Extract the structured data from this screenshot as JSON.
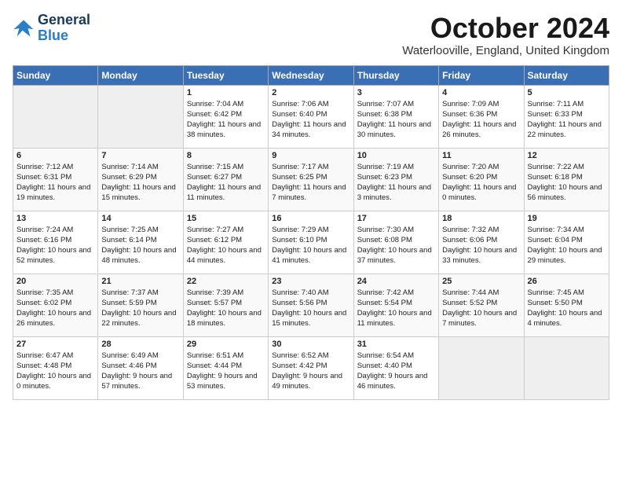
{
  "header": {
    "logo_general": "General",
    "logo_blue": "Blue",
    "month": "October 2024",
    "location": "Waterlooville, England, United Kingdom"
  },
  "weekdays": [
    "Sunday",
    "Monday",
    "Tuesday",
    "Wednesday",
    "Thursday",
    "Friday",
    "Saturday"
  ],
  "weeks": [
    [
      {
        "day": "",
        "info": ""
      },
      {
        "day": "",
        "info": ""
      },
      {
        "day": "1",
        "info": "Sunrise: 7:04 AM\nSunset: 6:42 PM\nDaylight: 11 hours and 38 minutes."
      },
      {
        "day": "2",
        "info": "Sunrise: 7:06 AM\nSunset: 6:40 PM\nDaylight: 11 hours and 34 minutes."
      },
      {
        "day": "3",
        "info": "Sunrise: 7:07 AM\nSunset: 6:38 PM\nDaylight: 11 hours and 30 minutes."
      },
      {
        "day": "4",
        "info": "Sunrise: 7:09 AM\nSunset: 6:36 PM\nDaylight: 11 hours and 26 minutes."
      },
      {
        "day": "5",
        "info": "Sunrise: 7:11 AM\nSunset: 6:33 PM\nDaylight: 11 hours and 22 minutes."
      }
    ],
    [
      {
        "day": "6",
        "info": "Sunrise: 7:12 AM\nSunset: 6:31 PM\nDaylight: 11 hours and 19 minutes."
      },
      {
        "day": "7",
        "info": "Sunrise: 7:14 AM\nSunset: 6:29 PM\nDaylight: 11 hours and 15 minutes."
      },
      {
        "day": "8",
        "info": "Sunrise: 7:15 AM\nSunset: 6:27 PM\nDaylight: 11 hours and 11 minutes."
      },
      {
        "day": "9",
        "info": "Sunrise: 7:17 AM\nSunset: 6:25 PM\nDaylight: 11 hours and 7 minutes."
      },
      {
        "day": "10",
        "info": "Sunrise: 7:19 AM\nSunset: 6:23 PM\nDaylight: 11 hours and 3 minutes."
      },
      {
        "day": "11",
        "info": "Sunrise: 7:20 AM\nSunset: 6:20 PM\nDaylight: 11 hours and 0 minutes."
      },
      {
        "day": "12",
        "info": "Sunrise: 7:22 AM\nSunset: 6:18 PM\nDaylight: 10 hours and 56 minutes."
      }
    ],
    [
      {
        "day": "13",
        "info": "Sunrise: 7:24 AM\nSunset: 6:16 PM\nDaylight: 10 hours and 52 minutes."
      },
      {
        "day": "14",
        "info": "Sunrise: 7:25 AM\nSunset: 6:14 PM\nDaylight: 10 hours and 48 minutes."
      },
      {
        "day": "15",
        "info": "Sunrise: 7:27 AM\nSunset: 6:12 PM\nDaylight: 10 hours and 44 minutes."
      },
      {
        "day": "16",
        "info": "Sunrise: 7:29 AM\nSunset: 6:10 PM\nDaylight: 10 hours and 41 minutes."
      },
      {
        "day": "17",
        "info": "Sunrise: 7:30 AM\nSunset: 6:08 PM\nDaylight: 10 hours and 37 minutes."
      },
      {
        "day": "18",
        "info": "Sunrise: 7:32 AM\nSunset: 6:06 PM\nDaylight: 10 hours and 33 minutes."
      },
      {
        "day": "19",
        "info": "Sunrise: 7:34 AM\nSunset: 6:04 PM\nDaylight: 10 hours and 29 minutes."
      }
    ],
    [
      {
        "day": "20",
        "info": "Sunrise: 7:35 AM\nSunset: 6:02 PM\nDaylight: 10 hours and 26 minutes."
      },
      {
        "day": "21",
        "info": "Sunrise: 7:37 AM\nSunset: 5:59 PM\nDaylight: 10 hours and 22 minutes."
      },
      {
        "day": "22",
        "info": "Sunrise: 7:39 AM\nSunset: 5:57 PM\nDaylight: 10 hours and 18 minutes."
      },
      {
        "day": "23",
        "info": "Sunrise: 7:40 AM\nSunset: 5:56 PM\nDaylight: 10 hours and 15 minutes."
      },
      {
        "day": "24",
        "info": "Sunrise: 7:42 AM\nSunset: 5:54 PM\nDaylight: 10 hours and 11 minutes."
      },
      {
        "day": "25",
        "info": "Sunrise: 7:44 AM\nSunset: 5:52 PM\nDaylight: 10 hours and 7 minutes."
      },
      {
        "day": "26",
        "info": "Sunrise: 7:45 AM\nSunset: 5:50 PM\nDaylight: 10 hours and 4 minutes."
      }
    ],
    [
      {
        "day": "27",
        "info": "Sunrise: 6:47 AM\nSunset: 4:48 PM\nDaylight: 10 hours and 0 minutes."
      },
      {
        "day": "28",
        "info": "Sunrise: 6:49 AM\nSunset: 4:46 PM\nDaylight: 9 hours and 57 minutes."
      },
      {
        "day": "29",
        "info": "Sunrise: 6:51 AM\nSunset: 4:44 PM\nDaylight: 9 hours and 53 minutes."
      },
      {
        "day": "30",
        "info": "Sunrise: 6:52 AM\nSunset: 4:42 PM\nDaylight: 9 hours and 49 minutes."
      },
      {
        "day": "31",
        "info": "Sunrise: 6:54 AM\nSunset: 4:40 PM\nDaylight: 9 hours and 46 minutes."
      },
      {
        "day": "",
        "info": ""
      },
      {
        "day": "",
        "info": ""
      }
    ]
  ]
}
